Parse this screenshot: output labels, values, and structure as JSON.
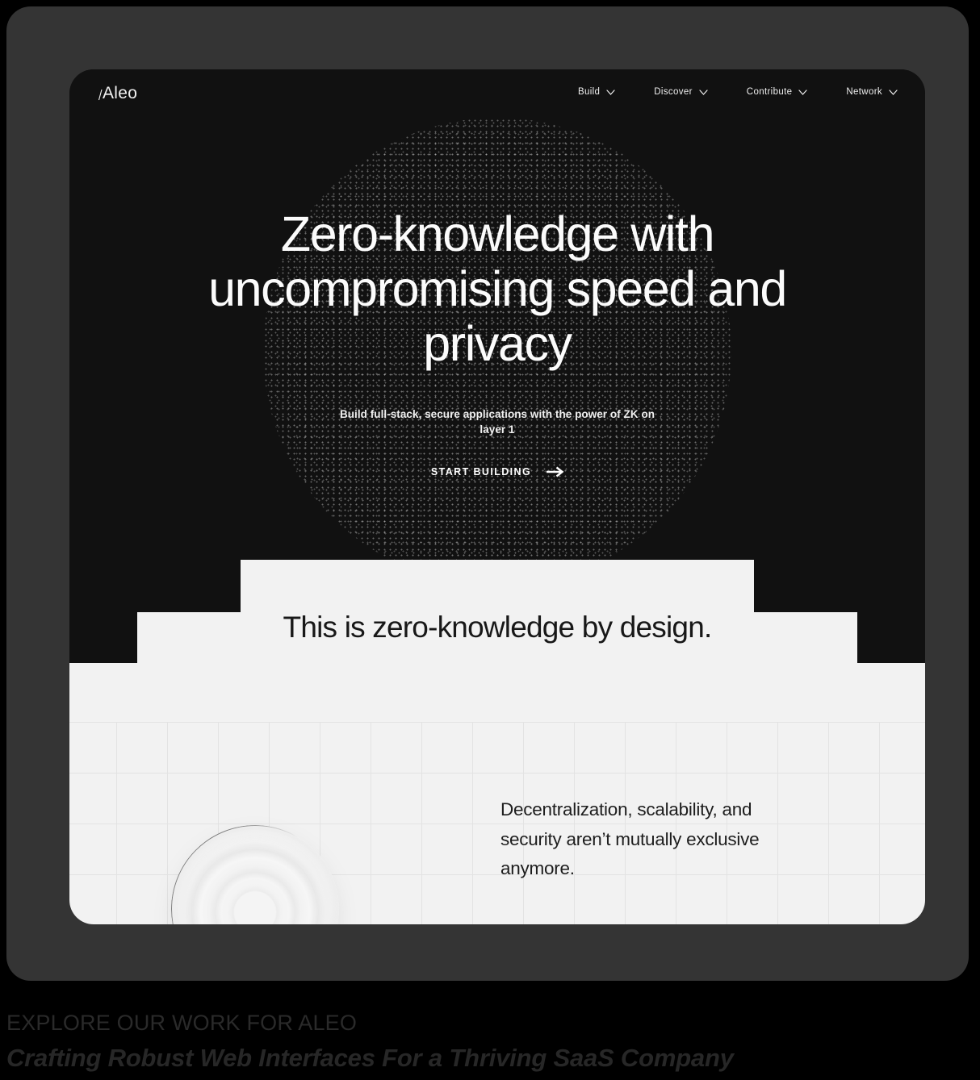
{
  "site": {
    "brand": "Aleo",
    "brand_mark_icon": "aleo-slash-icon",
    "nav": [
      {
        "label": "Build",
        "icon": "chevron-down-icon"
      },
      {
        "label": "Discover",
        "icon": "chevron-down-icon"
      },
      {
        "label": "Contribute",
        "icon": "chevron-down-icon"
      },
      {
        "label": "Network",
        "icon": "chevron-down-icon"
      }
    ]
  },
  "hero": {
    "headline": "Zero-knowledge with uncompromising speed and privacy",
    "subhead": "Build full-stack, secure applications with the power of ZK on layer 1",
    "cta_label": "START BUILDING",
    "cta_icon": "arrow-right-icon",
    "background_graphic": "dotted-sphere-graphic"
  },
  "light_section": {
    "heading": "This is zero-knowledge by design.",
    "paragraph": "Decentralization, scalability, and security aren’t mutually exclusive anymore.",
    "graphic": "concentric-disc-graphic"
  },
  "caption": {
    "kicker": "EXPLORE OUR WORK FOR ALEO",
    "title": "Crafting Robust Web Interfaces For a Thriving SaaS Company"
  },
  "colors": {
    "page_background": "#000000",
    "device_frame": "#343434",
    "panel_dark": "#111111",
    "panel_light": "#f2f2f2",
    "grid_line": "#e3e3e3",
    "text_light": "#fbfbfb",
    "text_dark": "#181818"
  }
}
